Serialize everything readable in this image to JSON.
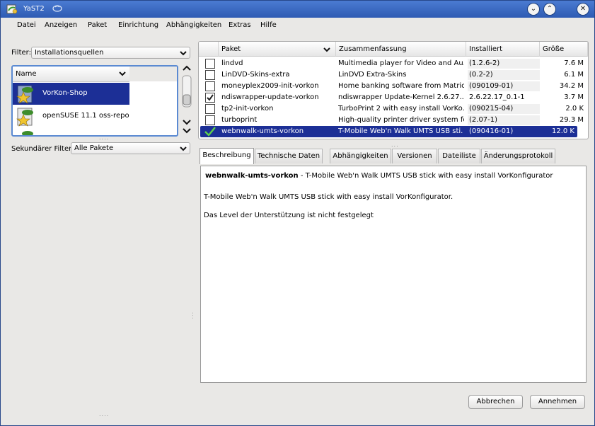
{
  "window": {
    "title": "YaST2"
  },
  "menu": [
    "Datei",
    "Anzeigen",
    "Paket",
    "Einrichtung",
    "Abhängigkeiten",
    "Extras",
    "Hilfe"
  ],
  "filter": {
    "label": "Filter:",
    "value": "Installationsquellen"
  },
  "repo_list": {
    "header": "Name",
    "items": [
      {
        "label": "VorKon-Shop",
        "selected": true
      },
      {
        "label": "openSUSE 11.1 oss-repo",
        "selected": false
      }
    ]
  },
  "secondary_filter": {
    "label": "Sekundärer Filter:",
    "value": "Alle Pakete"
  },
  "packages": {
    "columns": [
      "Paket",
      "Zusammenfassung",
      "Installiert (Verfügbar)",
      "Größe"
    ],
    "rows": [
      {
        "name": "lindvd",
        "summary": "Multimedia player for Video and Au...",
        "version": "(1.2.6-2)",
        "size": "7.6 M",
        "status": "available",
        "selected": false
      },
      {
        "name": "LinDVD-Skins-extra",
        "summary": "LinDVD Extra-Skins",
        "version": "(0.2-2)",
        "size": "6.1 M",
        "status": "available",
        "selected": false
      },
      {
        "name": "moneyplex2009-init-vorkon",
        "summary": "Home banking software from Matric...",
        "version": "(090109-01)",
        "size": "34.2 M",
        "status": "available",
        "selected": false
      },
      {
        "name": "ndiswrapper-update-vorkon",
        "summary": "ndiswrapper Update-Kernel 2.6.27....",
        "version": "2.6.22.17_0.1-1",
        "size": "3.7 M",
        "status": "installed",
        "selected": false
      },
      {
        "name": "tp2-init-vorkon",
        "summary": "TurboPrint 2 with easy install VorKo...",
        "version": "(090215-04)",
        "size": "2.0 K",
        "status": "available",
        "selected": false
      },
      {
        "name": "turboprint",
        "summary": "High-quality printer driver system for ...",
        "version": "(2.07-1)",
        "size": "29.3 M",
        "status": "available",
        "selected": false
      },
      {
        "name": "webnwalk-umts-vorkon",
        "summary": "T-Mobile Web'n Walk UMTS USB sti...",
        "version": "(090416-01)",
        "size": "12.0 K",
        "status": "install",
        "selected": true
      }
    ]
  },
  "tabs": [
    "Beschreibung",
    "Technische Daten",
    "Abhängigkeiten",
    "Versionen",
    "Dateiliste",
    "Änderungsprotokoll"
  ],
  "description": {
    "pkg_name": "webnwalk-umts-vorkon",
    "heading_rest": " - T-Mobile Web'n Walk UMTS USB stick with easy install VorKonfigurator",
    "body": "T-Mobile Web'n Walk UMTS USB stick with easy install VorKonfigurator.",
    "support": "Das Level der Unterstützung ist nicht festgelegt"
  },
  "buttons": {
    "cancel": "Abbrechen",
    "accept": "Annehmen"
  },
  "colors": {
    "selection": "#1c2f96",
    "titlebar": "#2e5bb3",
    "focus_border": "#5b8ad2"
  }
}
